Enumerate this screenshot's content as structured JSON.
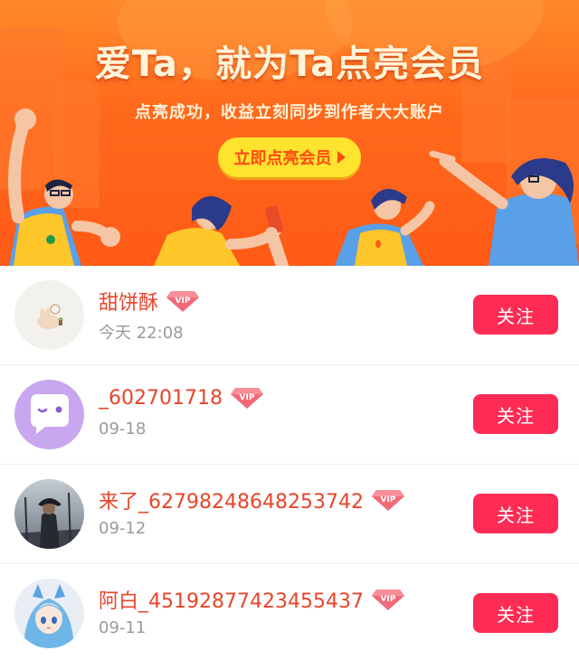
{
  "banner": {
    "title": "爱Ta，就为Ta点亮会员",
    "subtitle": "点亮成功，收益立刻同步到作者大大账户",
    "cta_label": "立即点亮会员"
  },
  "users": [
    {
      "name": "甜饼酥",
      "time": "今天 22:08",
      "follow_label": "关注",
      "vip_text": "VIP"
    },
    {
      "name": "_602701718",
      "time": "09-18",
      "follow_label": "关注",
      "vip_text": "VIP"
    },
    {
      "name": "来了_62798248648253742",
      "time": "09-12",
      "follow_label": "关注",
      "vip_text": "VIP"
    },
    {
      "name": "阿白_45192877423455437",
      "time": "09-11",
      "follow_label": "关注",
      "vip_text": "VIP"
    }
  ],
  "colors": {
    "accent": "#fe2c55",
    "name": "#e8452a",
    "banner": "#ff6a1c",
    "cta": "#ffe42e"
  }
}
